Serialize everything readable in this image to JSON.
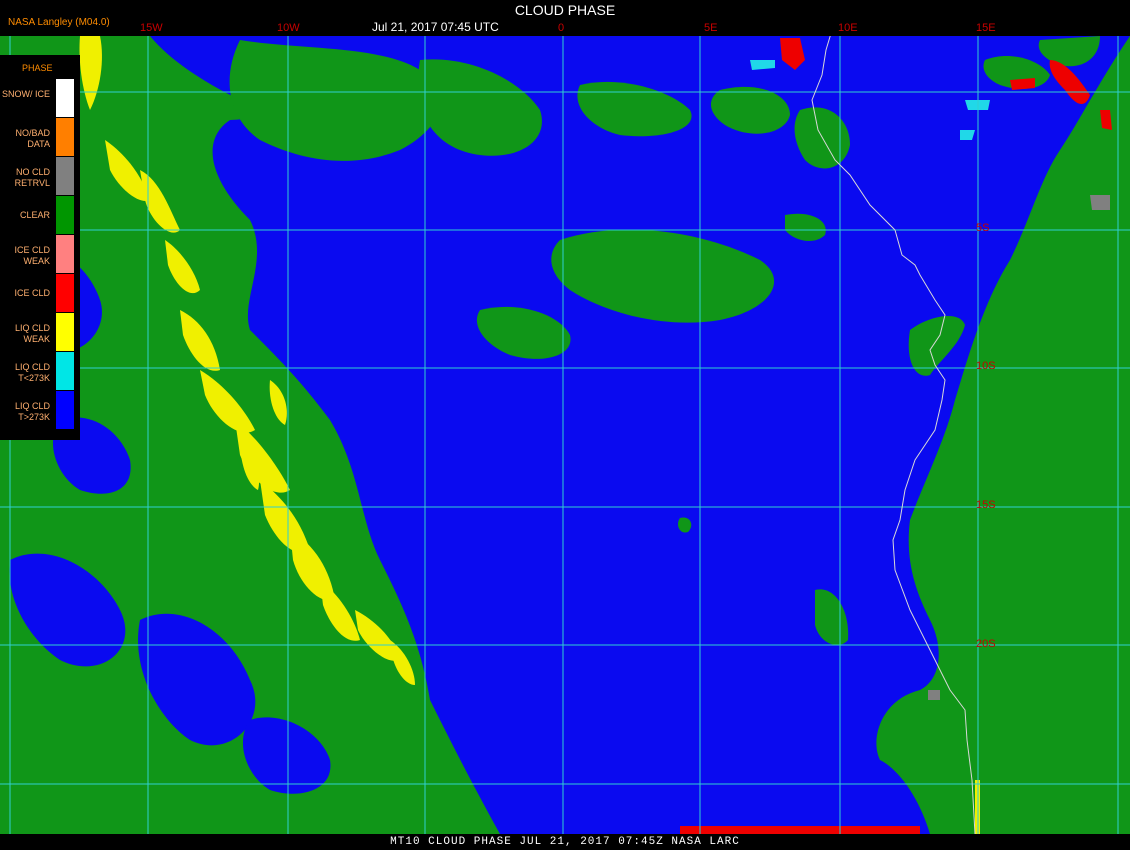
{
  "header": {
    "producer": "NASA Langley (M04.0)",
    "title": "CLOUD PHASE",
    "datetime": "Jul 21, 2017 07:45 UTC"
  },
  "lon_labels": [
    "15W",
    "10W",
    "0",
    "5E",
    "10E",
    "15E"
  ],
  "lat_labels": [
    "5S",
    "10S",
    "15S",
    "20S"
  ],
  "legend": {
    "title": "PHASE",
    "items": [
      {
        "label": "SNOW/ ICE",
        "color": "#ffffff"
      },
      {
        "label": "NO/BAD DATA",
        "color": "#ff7f00"
      },
      {
        "label": "NO CLD RETRVL",
        "color": "#808080"
      },
      {
        "label": "CLEAR",
        "color": "#009600"
      },
      {
        "label": "ICE CLD WEAK",
        "color": "#ff8080"
      },
      {
        "label": "ICE CLD",
        "color": "#ff0000"
      },
      {
        "label": "LIQ CLD WEAK",
        "color": "#ffff00"
      },
      {
        "label": "LIQ CLD T<273K",
        "color": "#00e6e6"
      },
      {
        "label": "LIQ CLD T>273K",
        "color": "#0000ff"
      }
    ]
  },
  "footer": "MT10  CLOUD PHASE   JUL 21, 2017 07:45Z   NASA LARC",
  "colors": {
    "ocean": "#0a0af0",
    "clear": "#109618",
    "liq_weak": "#f0f000",
    "grid": "#30d0d0",
    "coast": "#d8d8d8"
  }
}
